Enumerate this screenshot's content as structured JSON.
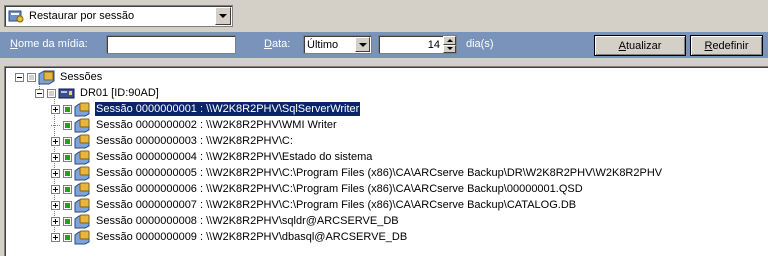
{
  "mode_select": {
    "value": "Restaurar por sessão",
    "icon": "restore-session-icon"
  },
  "filter_bar": {
    "media_label_prefix": "N",
    "media_label_rest": "ome da mídia:",
    "media_value": "",
    "date_label_prefix": "D",
    "date_label_rest": "ata:",
    "date_value": "Último",
    "days_value": "14",
    "days_unit": "dia(s)",
    "update_prefix": "A",
    "update_rest": "tualizar",
    "reset_prefix": "R",
    "reset_rest": "edefinir",
    "bar_color": "#7a93bb"
  },
  "tree": {
    "root_label": "Sessões",
    "server_label": "DR01 [ID:90AD]",
    "sessions": [
      {
        "label": "Sessão 0000000001 : \\\\W2K8R2PHV\\SqlServerWriter",
        "expandable": true,
        "selected": true
      },
      {
        "label": "Sessão 0000000002 : \\\\W2K8R2PHV\\WMI Writer",
        "expandable": false,
        "selected": false
      },
      {
        "label": "Sessão 0000000003 : \\\\W2K8R2PHV\\C:",
        "expandable": true,
        "selected": false
      },
      {
        "label": "Sessão 0000000004 : \\\\W2K8R2PHV\\Estado do sistema",
        "expandable": true,
        "selected": false
      },
      {
        "label": "Sessão 0000000005 : \\\\W2K8R2PHV\\C:\\Program Files (x86)\\CA\\ARCserve Backup\\DR\\W2K8R2PHV\\W2K8R2PHV",
        "expandable": true,
        "selected": false
      },
      {
        "label": "Sessão 0000000006 : \\\\W2K8R2PHV\\C:\\Program Files (x86)\\CA\\ARCserve Backup\\00000001.QSD",
        "expandable": true,
        "selected": false
      },
      {
        "label": "Sessão 0000000007 : \\\\W2K8R2PHV\\C:\\Program Files (x86)\\CA\\ARCserve Backup\\CATALOG.DB",
        "expandable": true,
        "selected": false
      },
      {
        "label": "Sessão 0000000008 : \\\\W2K8R2PHV\\sqldr@ARCSERVE_DB",
        "expandable": true,
        "selected": false
      },
      {
        "label": "Sessão 0000000009 : \\\\W2K8R2PHV\\dbasql@ARCSERVE_DB",
        "expandable": true,
        "selected": false
      }
    ],
    "selection_color": "#0a246a",
    "check_color": "#1fa31f"
  }
}
